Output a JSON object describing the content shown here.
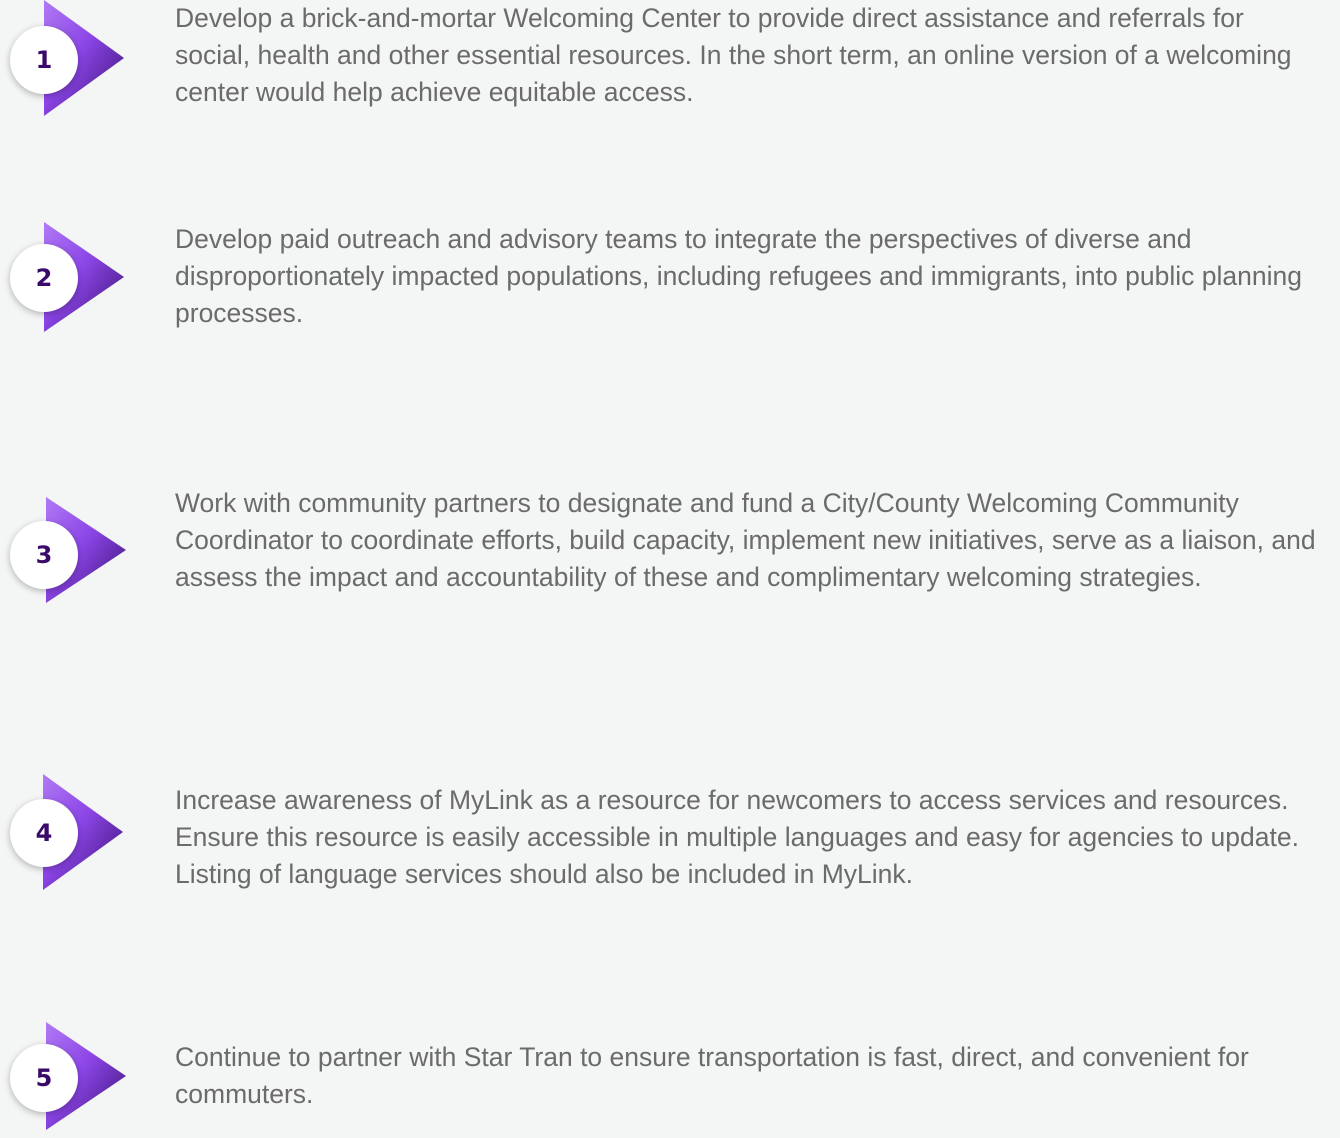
{
  "colors": {
    "background": "#f4f5f5",
    "arrow_light": "#a46cf0",
    "arrow_dark": "#3b0f78",
    "number": "#3a0a6b",
    "text": "#6b6b6b"
  },
  "items": [
    {
      "number": "1",
      "icon": "triangle-arrow-icon",
      "text": "Develop a brick-and-mortar Welcoming Center to provide direct assistance and referrals for social, health and other essential resources. In the short term, an online version of a welcoming center would help achieve equitable access."
    },
    {
      "number": "2",
      "icon": "triangle-arrow-icon",
      "text": "Develop paid outreach and advisory teams to integrate the perspectives of diverse and disproportionately impacted populations, including refugees and immigrants, into public planning processes."
    },
    {
      "number": "3",
      "icon": "triangle-arrow-icon",
      "text": "Work with community partners to designate and fund a City/County Welcoming Community Coordinator to coordinate efforts, build capacity, implement new initiatives, serve as a liaison, and assess the impact and accountability of these and complimentary welcoming strategies."
    },
    {
      "number": "4",
      "icon": "triangle-arrow-icon",
      "text": "Increase awareness of MyLink as a resource for newcomers to access services and resources. Ensure this resource is easily accessible in multiple languages and easy for agencies to update. Listing of language services should also be included in MyLink."
    },
    {
      "number": "5",
      "icon": "triangle-arrow-icon",
      "text": "Continue to partner with Star Tran to ensure transportation is fast, direct, and convenient for commuters."
    }
  ]
}
